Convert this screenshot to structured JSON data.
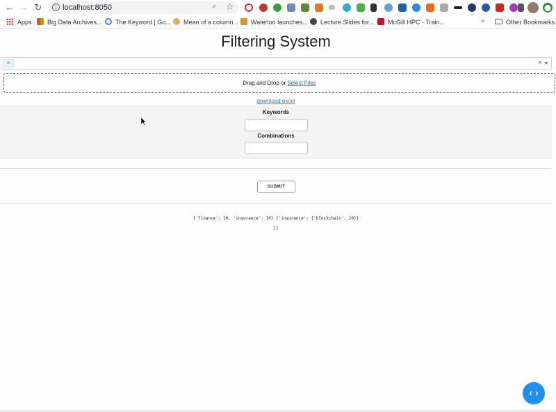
{
  "browser": {
    "url": "localhost:8050",
    "bookmarks": [
      {
        "label": "Apps"
      },
      {
        "label": "Big Data Archives..."
      },
      {
        "label": "The Keyword | Go..."
      },
      {
        "label": "Mean of a column..."
      },
      {
        "label": "Waterloo launches..."
      },
      {
        "label": "Lecture Slides for..."
      },
      {
        "label": "McGill HPC - Train..."
      }
    ],
    "more": "»",
    "other_bookmarks": "Other Bookmarks"
  },
  "page": {
    "title": "Filtering System",
    "dropdown": {
      "tag_remove": "×",
      "clear": "×"
    },
    "upload": {
      "text": "Drag and Drop or ",
      "link": "Select Files"
    },
    "download_link": "download excel",
    "form": {
      "keywords_label": "Keywords",
      "combinations_label": "Combinations",
      "keywords_value": "",
      "combinations_value": ""
    },
    "submit_label": "SUBMIT",
    "output_line1": "{'finance': 10, 'insurance': 10} {'insurance': {'blockchain': 20}}",
    "output_line2": "[]",
    "fab_label": "‹ ›"
  }
}
